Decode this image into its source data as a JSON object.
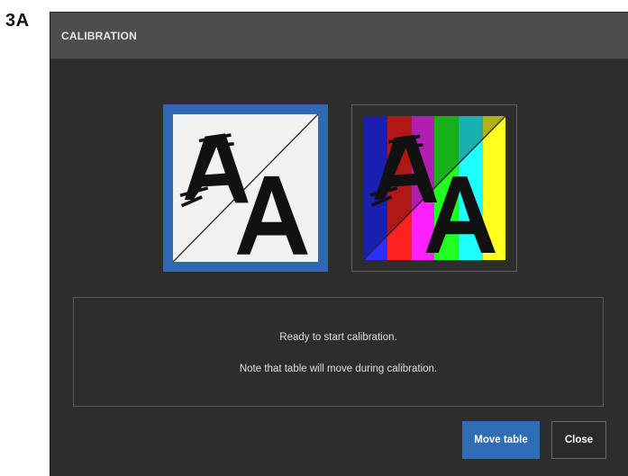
{
  "figure_label": "3A",
  "dialog": {
    "title": "CALIBRATION",
    "modes": [
      {
        "icon": "grayscale-pattern-icon",
        "selected": true
      },
      {
        "icon": "color-bars-pattern-icon",
        "selected": false
      }
    ],
    "status": {
      "line1": "Ready to start calibration.",
      "line2": "Note that table will move during calibration."
    },
    "buttons": {
      "move_table": "Move table",
      "close": "Close"
    }
  },
  "colors": {
    "accent": "#3068b3",
    "dialog_background": "#2d2d2d",
    "titlebar": "#4d4d4d"
  }
}
